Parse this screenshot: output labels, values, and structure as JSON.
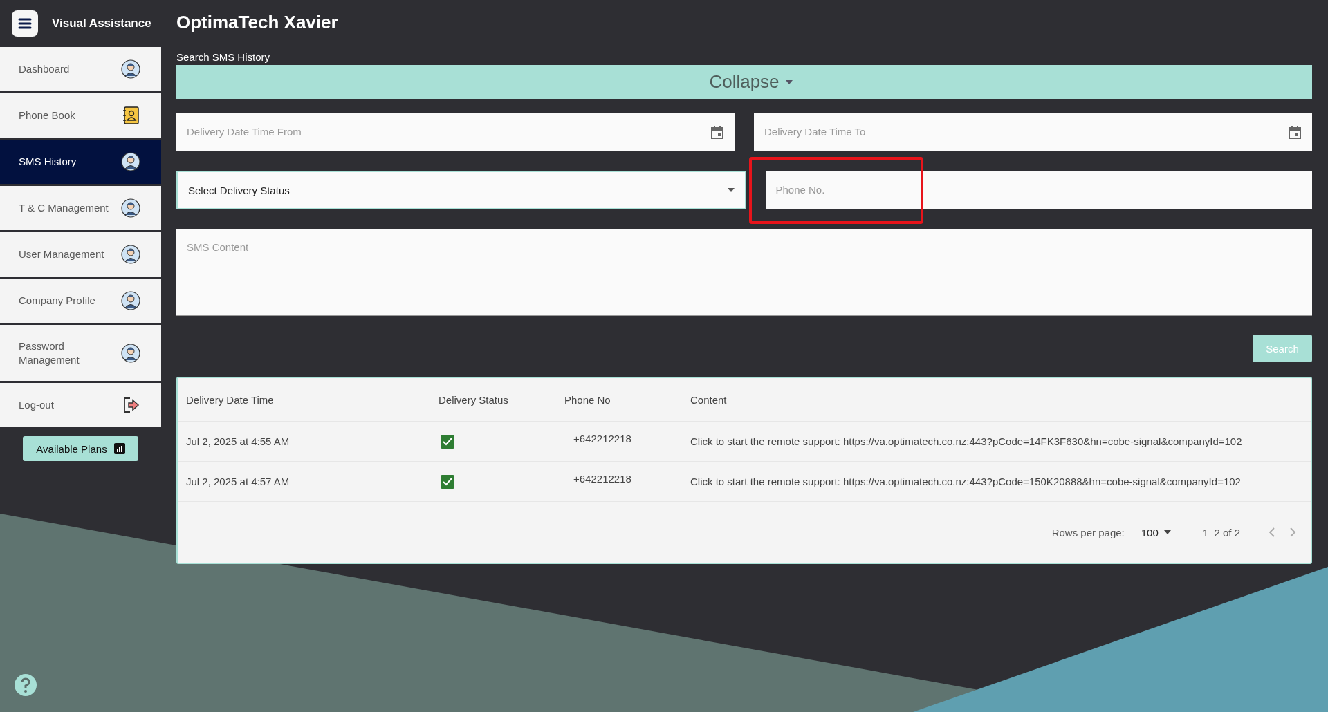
{
  "app": {
    "name": "Visual Assistance"
  },
  "sidebar": {
    "items": [
      {
        "label": "Dashboard",
        "kind": "avatar",
        "selected": false
      },
      {
        "label": "Phone Book",
        "kind": "phonebook",
        "selected": false
      },
      {
        "label": "SMS History",
        "kind": "avatar",
        "selected": true
      },
      {
        "label": "T & C Management",
        "kind": "avatar",
        "selected": false
      },
      {
        "label": "User Management",
        "kind": "avatar",
        "selected": false
      },
      {
        "label": "Company Profile",
        "kind": "avatar",
        "selected": false
      },
      {
        "label": "Password Management",
        "kind": "avatar",
        "selected": false
      },
      {
        "label": "Log-out",
        "kind": "logout",
        "selected": false
      }
    ],
    "plans_button": "Available Plans"
  },
  "page_title": "OptimaTech Xavier",
  "search": {
    "heading": "Search SMS History",
    "collapse_label": "Collapse",
    "date_from": {
      "placeholder": "Delivery Date Time From"
    },
    "date_to": {
      "placeholder": "Delivery Date Time To"
    },
    "status_select": "Select Delivery Status",
    "phone": {
      "placeholder": "Phone No.",
      "highlighted": true
    },
    "content": {
      "placeholder": "SMS Content"
    },
    "search_button": "Search"
  },
  "table": {
    "columns": [
      "Delivery Date Time",
      "Delivery Status",
      "Phone No",
      "Content"
    ],
    "rows": [
      {
        "date": "Jul 2, 2025 at 4:55 AM",
        "delivered": true,
        "phone": "+642212218",
        "content": "Click to start the remote support: https://va.optimatech.co.nz:443?pCode=14FK3F630&hn=cobe-signal&companyId=102"
      },
      {
        "date": "Jul 2, 2025 at 4:57 AM",
        "delivered": true,
        "phone": "+642212218",
        "content": "Click to start the remote support: https://va.optimatech.co.nz:443?pCode=150K20888&hn=cobe-signal&companyId=102"
      }
    ],
    "pagination": {
      "rows_per_page_label": "Rows per page:",
      "rows_per_page": "100",
      "range": "1–2 of 2"
    }
  }
}
